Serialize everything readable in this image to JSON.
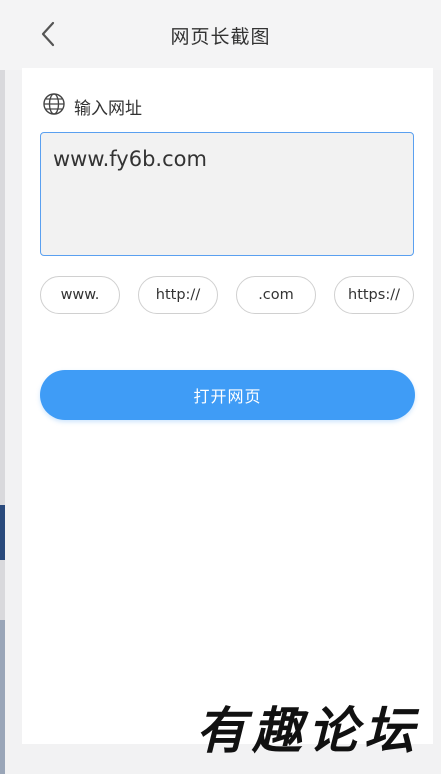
{
  "header": {
    "title": "网页长截图",
    "back_icon": "chevron-left-icon"
  },
  "form": {
    "label": "输入网址",
    "label_icon": "globe-icon",
    "url_value": "www.fy6b.com"
  },
  "chips": [
    {
      "label": "www."
    },
    {
      "label": "http://"
    },
    {
      "label": ".com"
    },
    {
      "label": "https://"
    }
  ],
  "open_button": {
    "label": "打开网页"
  },
  "watermark": {
    "text": "有趣论坛"
  },
  "colors": {
    "accent": "#3f9cf6",
    "input_border": "#5aa0f0",
    "page_bg": "#f2f2f3",
    "card_bg": "#ffffff"
  }
}
